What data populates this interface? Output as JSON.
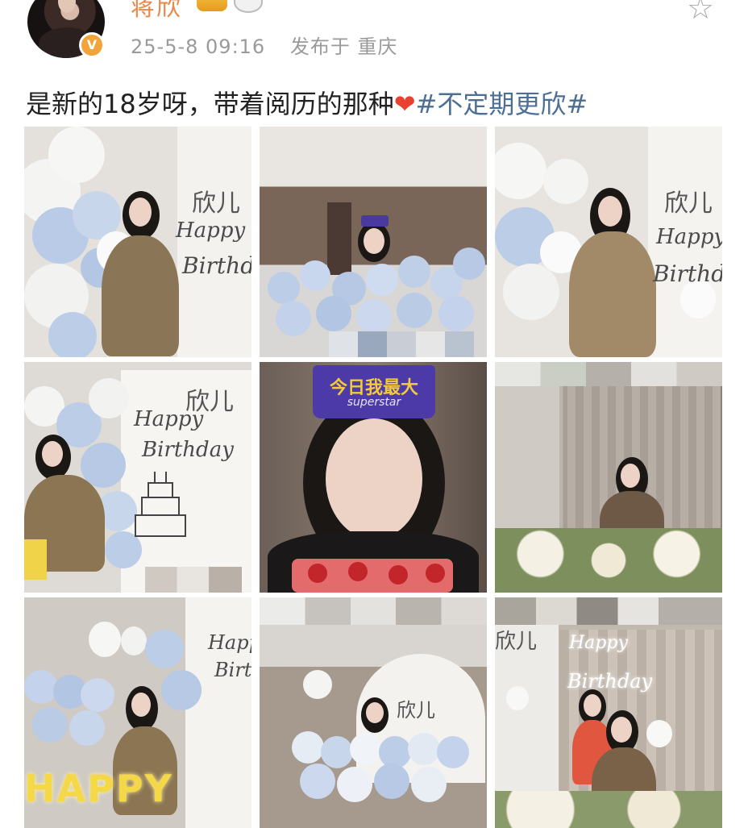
{
  "post": {
    "username": "蒋欣",
    "verified_badge": "V",
    "favorite_icon": "☆",
    "time": "25-5-8 09:16",
    "location": "发布于 重庆",
    "text": "是新的18岁呀，带着阅历的那种",
    "heart": "❤",
    "topic": "#不定期更欣#"
  },
  "photos": {
    "p1": {
      "sign": "欣儿",
      "happy": "Happy",
      "birthday": "Birthday"
    },
    "p3": {
      "sign": "欣儿",
      "happy": "Happy",
      "birthday": "Birthday"
    },
    "p4": {
      "sign": "欣儿",
      "happy": "Happy",
      "birthday": "Birthday"
    },
    "p5": {
      "crown_text": "今日我最大",
      "crown_sub": "superstar"
    },
    "p7": {
      "happy": "Happy",
      "birthday": "Birthday",
      "marquee": "HAPPY"
    },
    "p8": {
      "sign": "欣儿"
    },
    "p9": {
      "sign": "欣儿",
      "happy": "Happy",
      "birthday": "Birthday"
    }
  },
  "colors": {
    "username": "#e8894a",
    "meta": "#9a9a9a",
    "topic": "#4d6f95",
    "heart": "#e8412f",
    "balloon_white": "#f4f4f2",
    "balloon_blue": "#b9cbe6"
  }
}
